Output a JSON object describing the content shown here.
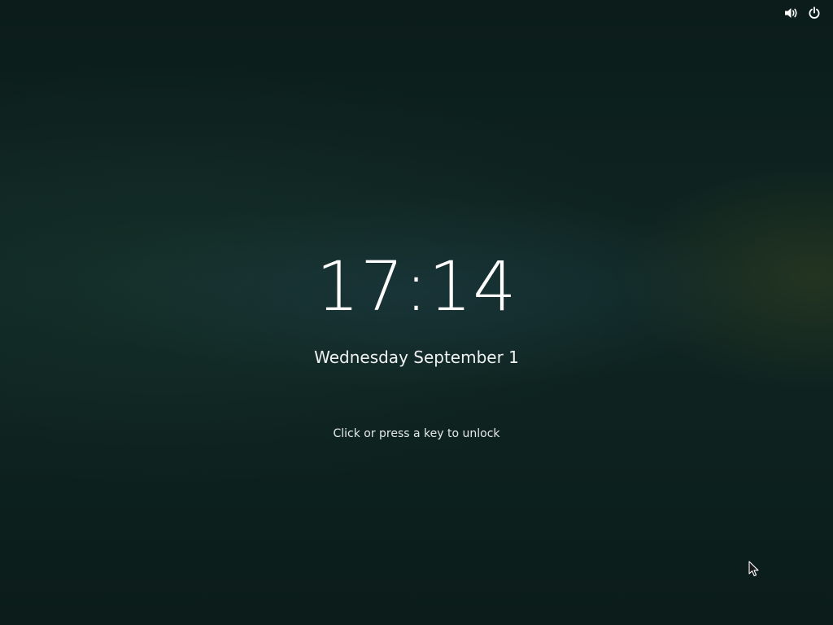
{
  "lock_screen": {
    "time": "17:14",
    "date": "Wednesday September 1",
    "unlock_hint": "Click or press a key to unlock"
  },
  "top_bar": {
    "icons": [
      "volume-icon",
      "power-icon"
    ]
  },
  "colors": {
    "background": "#0c1f1c",
    "text": "#ffffff"
  }
}
